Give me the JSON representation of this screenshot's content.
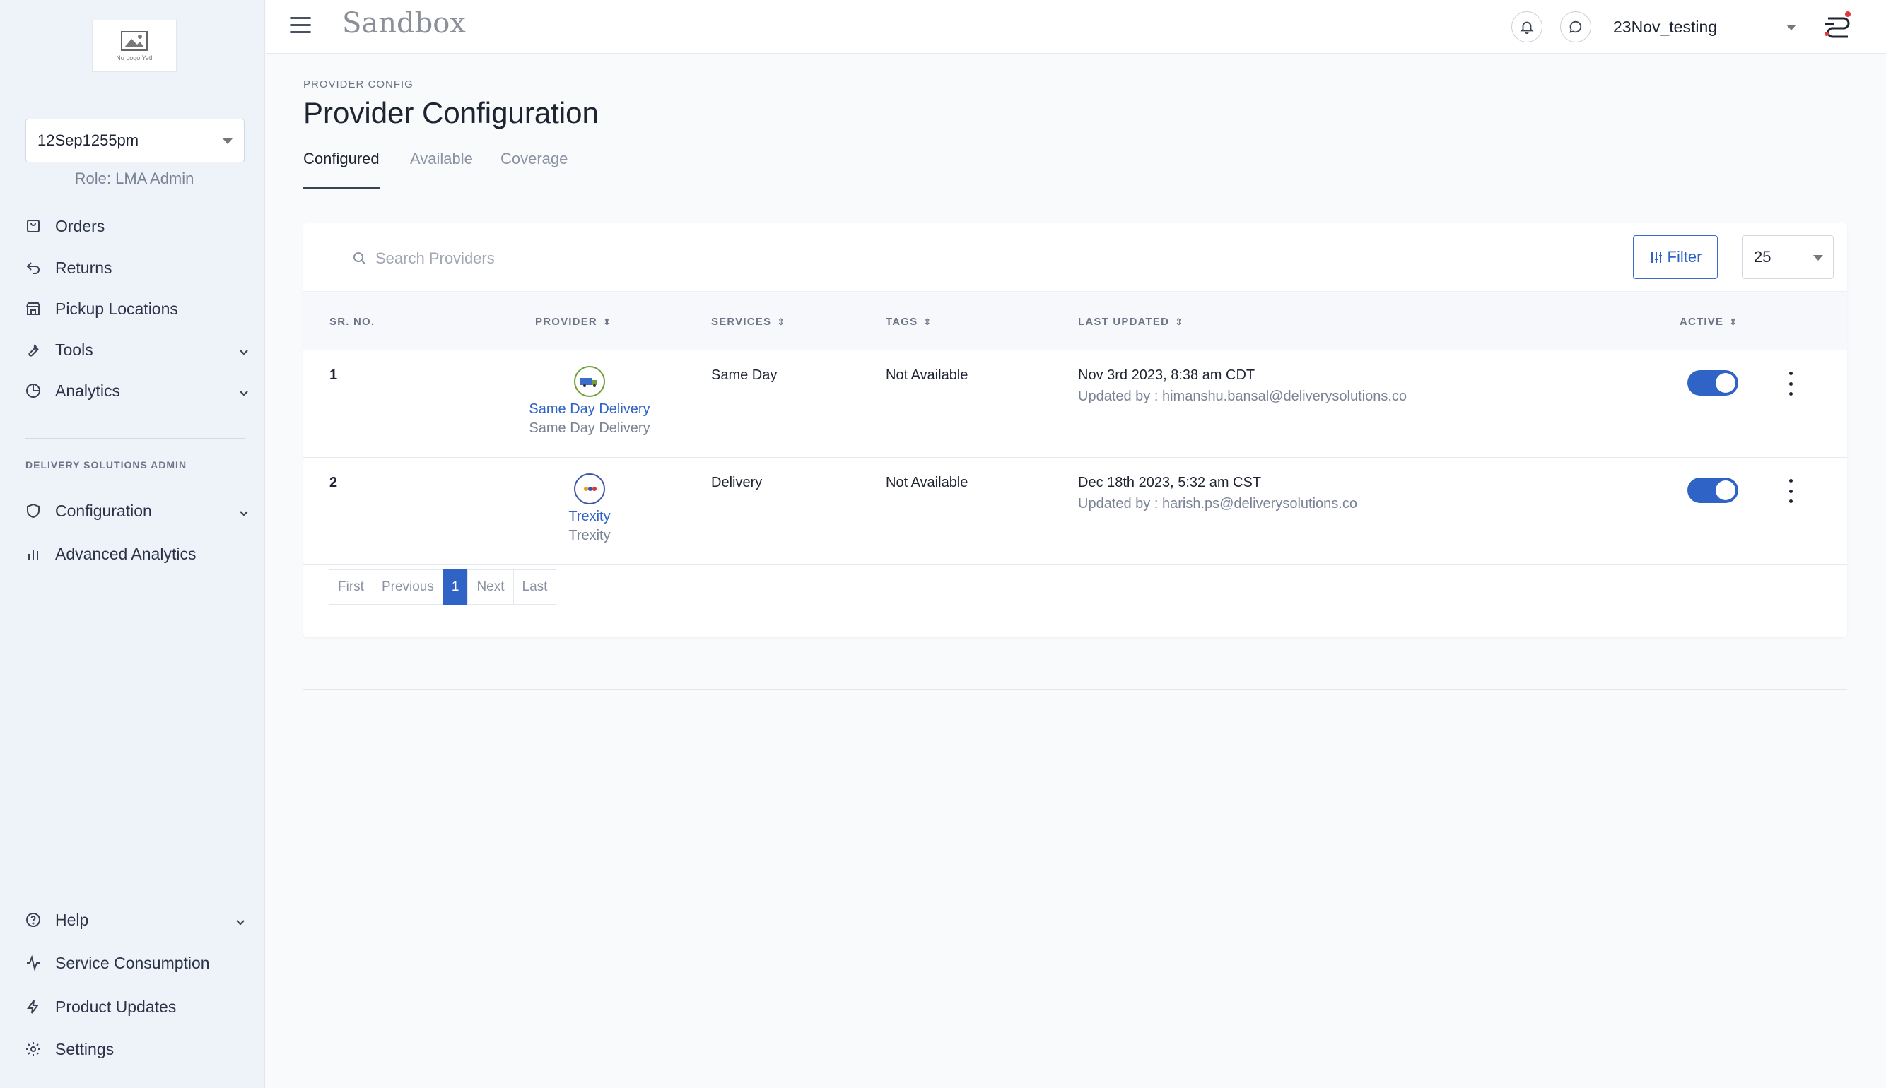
{
  "sidebar": {
    "logo_text": "No Logo Yet!",
    "account": "12Sep1255pm",
    "role": "Role: LMA Admin",
    "items": [
      {
        "label": "Orders",
        "icon": "shopping-bag-icon"
      },
      {
        "label": "Returns",
        "icon": "return-arrow-icon"
      },
      {
        "label": "Pickup Locations",
        "icon": "store-icon"
      },
      {
        "label": "Tools",
        "icon": "wrench-icon"
      },
      {
        "label": "Analytics",
        "icon": "pie-chart-icon"
      }
    ],
    "section_label": "DELIVERY SOLUTIONS ADMIN",
    "admin_items": [
      {
        "label": "Configuration",
        "icon": "shield-icon"
      },
      {
        "label": "Advanced Analytics",
        "icon": "bar-chart-icon"
      }
    ],
    "bottom_items": [
      {
        "label": "Help",
        "icon": "help-circle-icon"
      },
      {
        "label": "Service Consumption",
        "icon": "activity-icon"
      },
      {
        "label": "Product Updates",
        "icon": "lightning-icon"
      },
      {
        "label": "Settings",
        "icon": "gear-icon"
      }
    ]
  },
  "header": {
    "brand": "Sandbox",
    "user": "23Nov_testing"
  },
  "main": {
    "breadcrumb": "PROVIDER CONFIG",
    "title": "Provider Configuration",
    "tabs": [
      {
        "label": "Configured",
        "active": true
      },
      {
        "label": "Available",
        "active": false
      },
      {
        "label": "Coverage",
        "active": false
      }
    ]
  },
  "table": {
    "search_placeholder": "Search Providers",
    "filter_label": "Filter",
    "page_size": "25",
    "columns": [
      "SR. NO.",
      "PROVIDER",
      "SERVICES",
      "TAGS",
      "LAST UPDATED",
      "ACTIVE"
    ],
    "rows": [
      {
        "sr": "1",
        "provider_name": "Same Day Delivery",
        "provider_sub": "Same Day Delivery",
        "services": "Same Day",
        "tags": "Not Available",
        "last_updated": "Nov 3rd 2023, 8:38 am CDT",
        "updated_by": "Updated by : himanshu.bansal@deliverysolutions.co",
        "active": true
      },
      {
        "sr": "2",
        "provider_name": "Trexity",
        "provider_sub": "Trexity",
        "services": "Delivery",
        "tags": "Not Available",
        "last_updated": "Dec 18th 2023, 5:32 am CST",
        "updated_by": "Updated by : harish.ps@deliverysolutions.co",
        "active": true
      }
    ],
    "pagination": [
      "First",
      "Previous",
      "1",
      "Next",
      "Last"
    ]
  },
  "colors": {
    "accent": "#2f63c6",
    "sidebar_bg": "#eef2f9"
  }
}
